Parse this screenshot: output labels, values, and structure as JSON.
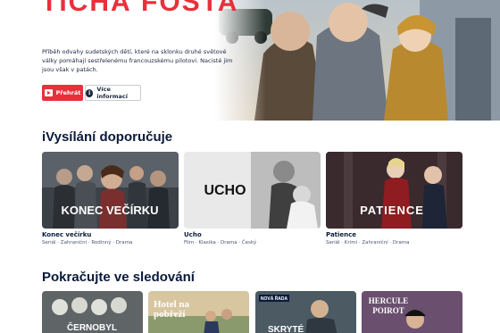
{
  "hero": {
    "title": "TICHÁ FOSTA",
    "description": "Příběh odvahy sudetských dětí, které na sklonku druhé světové války pomáhají sestřelenému francouzskému pilotovi. Nacisté jim jsou však v patách.",
    "play_label": "Přehrát",
    "info_label": "Více informací"
  },
  "section_recommended": {
    "title": "iVysílání doporučuje",
    "cards": [
      {
        "name": "Konec večírku",
        "meta": "Seriál · Zahraniční · Rodinný · Drama",
        "poster_text": "KONEC VEČÍRKU"
      },
      {
        "name": "Ucho",
        "meta": "Film · Klasika · Drama · Český",
        "poster_text": "UCHO"
      },
      {
        "name": "Patience",
        "meta": "Seriál · Krimi · Zahraniční · Drama",
        "poster_text": "PATIENCE"
      }
    ]
  },
  "section_continue": {
    "title": "Pokračujte ve sledování",
    "cards": [
      {
        "poster_text": "ČERNOBYL"
      },
      {
        "poster_text": "Hotel na pobřeží"
      },
      {
        "poster_text": "SKRYTÉ",
        "badge": "NOVÁ ŘADA"
      },
      {
        "poster_text": "HERCULE POIROT"
      }
    ]
  },
  "colors": {
    "accent": "#e8303b",
    "heading": "#0b1a3a"
  }
}
